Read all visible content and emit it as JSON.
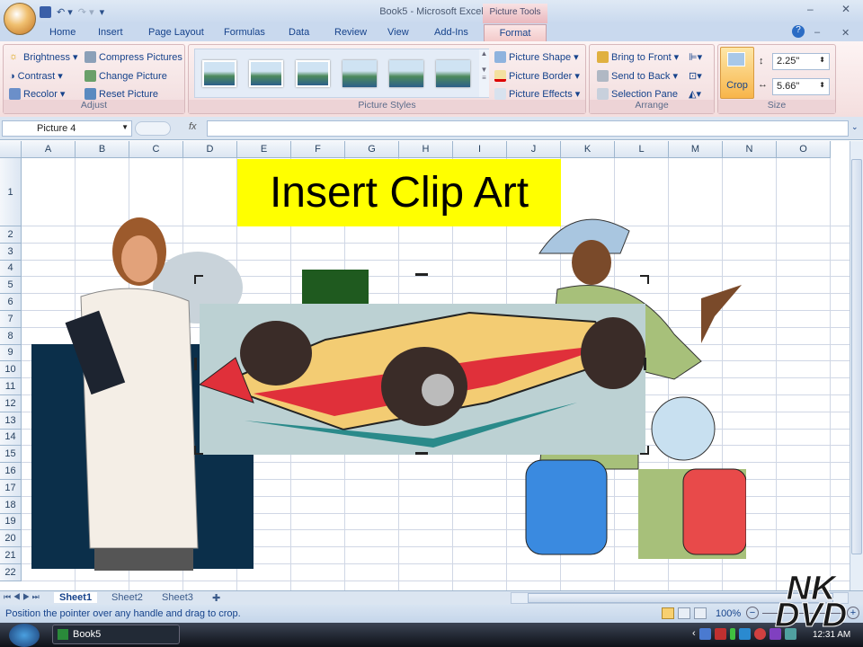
{
  "window": {
    "title": "Book5 - Microsoft Excel",
    "context_tab": "Picture Tools"
  },
  "tabs": [
    "Home",
    "Insert",
    "Page Layout",
    "Formulas",
    "Data",
    "Review",
    "View",
    "Add-Ins",
    "Format"
  ],
  "ribbon": {
    "adjust": {
      "label": "Adjust",
      "brightness": "Brightness",
      "contrast": "Contrast",
      "recolor": "Recolor",
      "compress": "Compress Pictures",
      "change": "Change Picture",
      "reset": "Reset Picture"
    },
    "styles": {
      "label": "Picture Styles",
      "shape": "Picture Shape",
      "border": "Picture Border",
      "effects": "Picture Effects"
    },
    "arrange": {
      "label": "Arrange",
      "front": "Bring to Front",
      "back": "Send to Back",
      "pane": "Selection Pane"
    },
    "size": {
      "label": "Size",
      "crop": "Crop",
      "height": "2.25\"",
      "width": "5.66\""
    }
  },
  "formula_bar": {
    "name_box": "Picture 4",
    "fx": "fx"
  },
  "columns": [
    "A",
    "B",
    "C",
    "D",
    "E",
    "F",
    "G",
    "H",
    "I",
    "J",
    "K",
    "L",
    "M",
    "N",
    "O"
  ],
  "rows": [
    "1",
    "2",
    "3",
    "4",
    "5",
    "6",
    "7",
    "8",
    "9",
    "10",
    "11",
    "12",
    "13",
    "14",
    "15",
    "16",
    "17",
    "18",
    "19",
    "20",
    "21",
    "22"
  ],
  "cell_text": "Insert Clip Art",
  "sheets": [
    "Sheet1",
    "Sheet2",
    "Sheet3"
  ],
  "status": {
    "message": "Position the pointer over any handle and drag to crop.",
    "zoom": "100%"
  },
  "taskbar": {
    "app": "Book5",
    "clock": "12:31 AM"
  },
  "watermark": "NK DVD"
}
